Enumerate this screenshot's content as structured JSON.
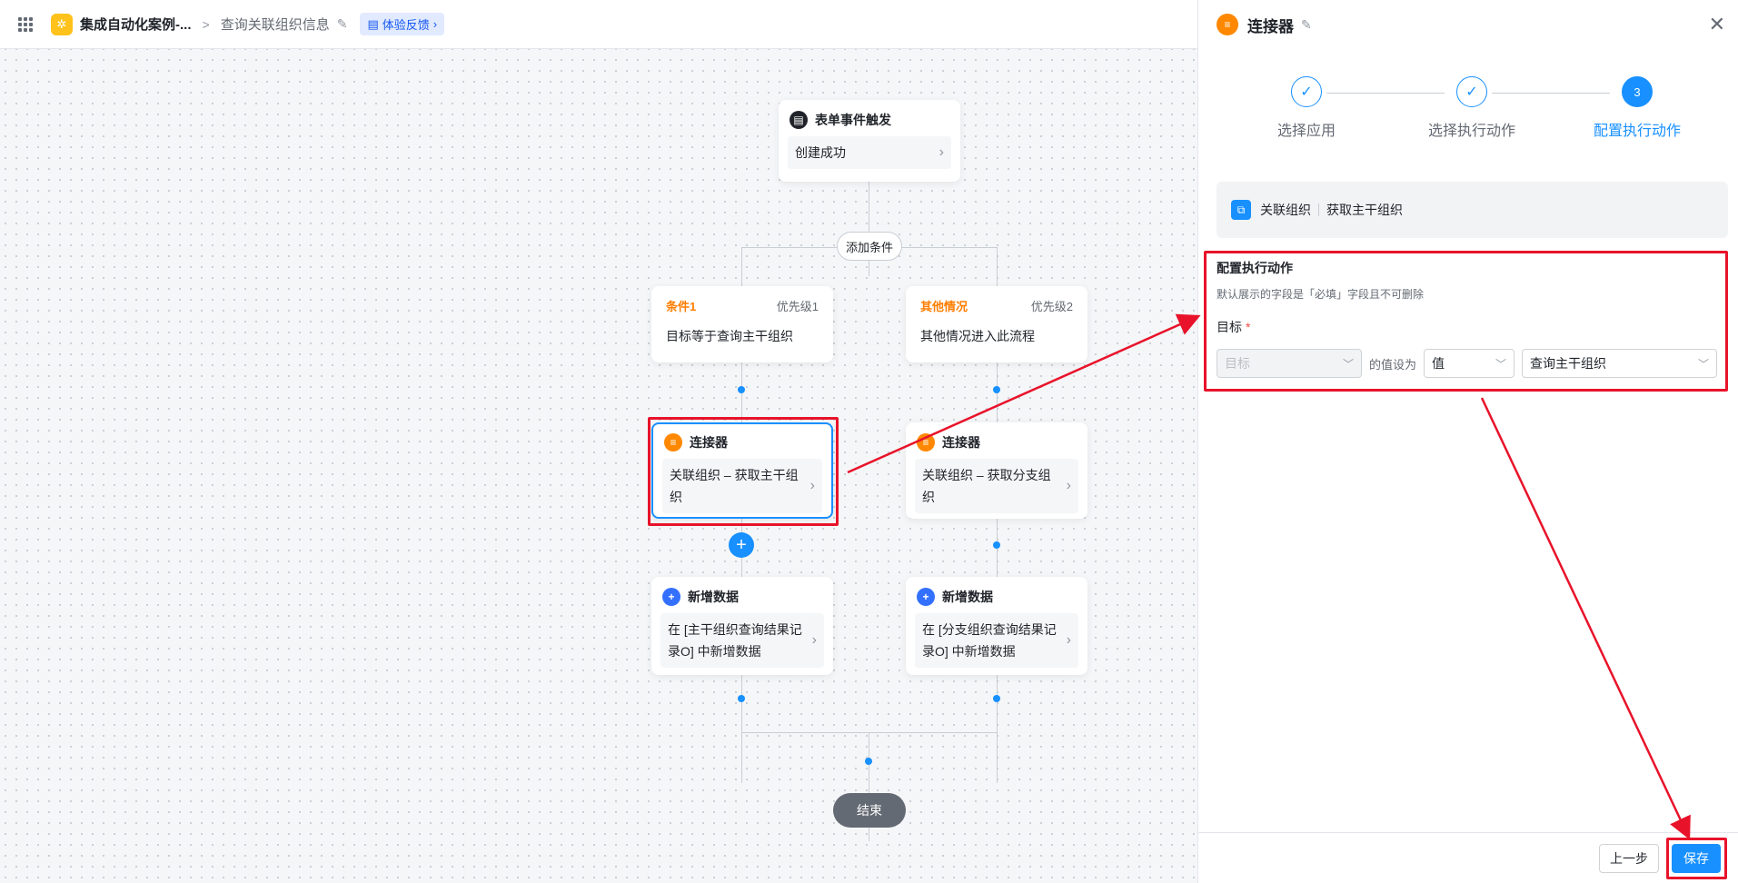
{
  "header": {
    "app_name": "集成自动化案例-...",
    "crumb_sep": ">",
    "page_name": "查询关联组织信息",
    "feedback_label": "体验反馈",
    "feedback_chevron": "›"
  },
  "flow": {
    "trigger": {
      "title": "表单事件触发",
      "body": "创建成功"
    },
    "add_condition_label": "添加条件",
    "branches": [
      {
        "cond_label": "条件1",
        "priority": "优先级1",
        "desc": "目标等于查询主干组织",
        "connector": {
          "title": "连接器",
          "body": "关联组织 – 获取主干组织"
        },
        "add_data": {
          "title": "新增数据",
          "body": "在 [主干组织查询结果记录O] 中新增数据"
        }
      },
      {
        "cond_label": "其他情况",
        "priority": "优先级2",
        "desc": "其他情况进入此流程",
        "connector": {
          "title": "连接器",
          "body": "关联组织 – 获取分支组织"
        },
        "add_data": {
          "title": "新增数据",
          "body": "在 [分支组织查询结果记录O] 中新增数据"
        }
      }
    ],
    "end_label": "结束",
    "chevron": "›",
    "plus": "+"
  },
  "panel": {
    "title": "连接器",
    "close": "✕",
    "steps": [
      {
        "label": "选择应用",
        "mark": "✓"
      },
      {
        "label": "选择执行动作",
        "mark": "✓"
      },
      {
        "label": "配置执行动作",
        "mark": "3"
      }
    ],
    "app_name": "关联组织",
    "action_name": "获取主干组织",
    "config_title": "配置执行动作",
    "config_hint": "默认展示的字段是「必填」字段且不可删除",
    "field_label": "目标",
    "required_mark": "*",
    "field_select_placeholder": "目标",
    "set_value_text": "的值设为",
    "value_type": "值",
    "value": "查询主干组织",
    "prev_button": "上一步",
    "save_button": "保存"
  },
  "colors": {
    "accent": "#1890ff",
    "annotation_red": "#e8132a",
    "condition_orange": "#ff7d00"
  },
  "icons": [
    "apps-grid-icon",
    "app-logo-icon",
    "chevron-right-icon",
    "edit-icon",
    "feedback-icon",
    "form-icon",
    "connector-icon",
    "plus-icon",
    "close-icon",
    "check-icon",
    "chevron-down-icon"
  ]
}
